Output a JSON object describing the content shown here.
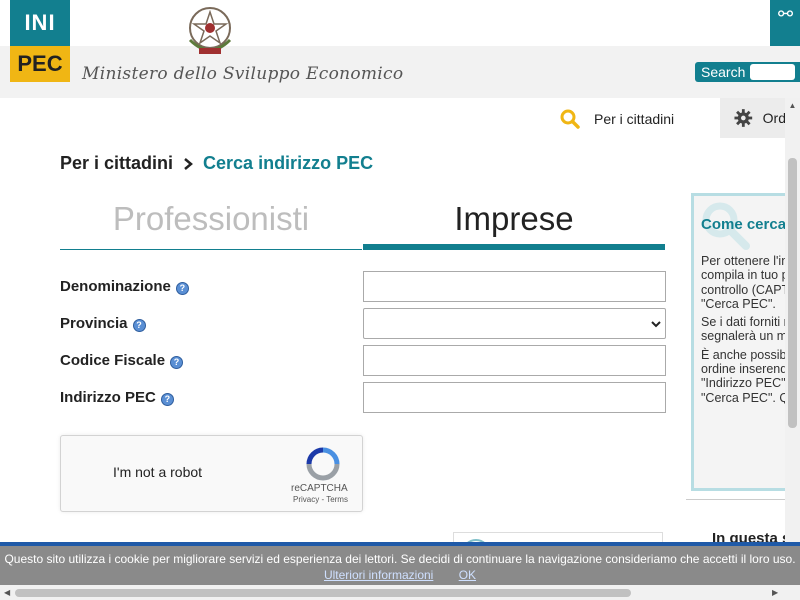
{
  "header": {
    "logo_top": "INI",
    "logo_bottom": "PEC",
    "ministry": "Ministero dello Sviluppo Economico",
    "search_label": "Search",
    "search_placeholder": ""
  },
  "nav": {
    "cittadini_label": "Per i cittadini",
    "ordini_label": "Ordini"
  },
  "breadcrumb": {
    "home": "Per i cittadini",
    "current": "Cerca indirizzo PEC"
  },
  "tabs": [
    {
      "label": "Professionisti",
      "active": false
    },
    {
      "label": "Imprese",
      "active": true
    }
  ],
  "form": {
    "fields": [
      {
        "label": "Denominazione",
        "value": ""
      },
      {
        "label": "Provincia",
        "value": ""
      },
      {
        "label": "Codice Fiscale",
        "value": ""
      },
      {
        "label": "Indirizzo PEC",
        "value": ""
      }
    ],
    "help_glyph": "?"
  },
  "recaptcha": {
    "label": "I'm not a robot",
    "brand": "reCAPTCHA",
    "links": "Privacy - Terms"
  },
  "side_panel": {
    "title": "Come cercare",
    "paragraphs": [
      "Per ottenere l'indirizzo desiderato, compila in tuo possesso e il controllo (CAPTCHA) bottone \"Cerca PEC\".",
      "Se i dati forniti risultare sufficienti segnalerà un messaggio.",
      "È anche possibile un'impresa o ordine inserendo l'indirizzo \"Indirizzo PEC\" e successivamente \"Cerca PEC\". Q anche come \"D"
    ],
    "heading2": "In questa sezione"
  },
  "cookie": {
    "text": "Questo sito utilizza i cookie per migliorare servizi ed esperienza dei lettori. Se decidi di continuare la navigazione consideriamo che accetti il loro uso.",
    "more_label": "Ulteriori informazioni",
    "ok_label": "OK"
  },
  "colors": {
    "accent": "#127f8f",
    "logo_yellow": "#f0b614",
    "cookie_bg": "#8a8a8a",
    "cookie_border": "#1f5aa8"
  },
  "icons": {
    "cittadini": "search-icon",
    "ordini": "gear-icon",
    "breadcrumb_sep": "chevron-right-icon"
  }
}
